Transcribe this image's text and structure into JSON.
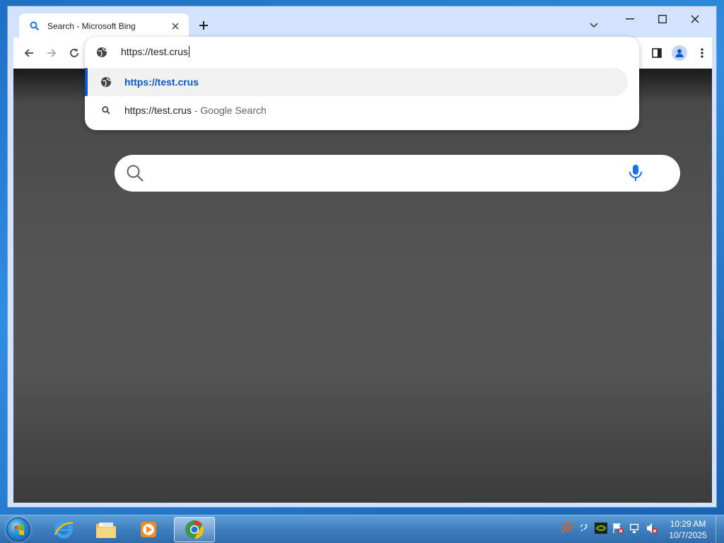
{
  "browser": {
    "tab": {
      "title": "Search - Microsoft Bing"
    },
    "omnibox": {
      "input_value": "https://test.crus",
      "suggestions": [
        {
          "text": "https://test.crus",
          "icon": "globe-icon"
        },
        {
          "text": "https://test.crus",
          "suffix": "Google Search",
          "separator": " - ",
          "icon": "search-icon"
        }
      ]
    }
  },
  "taskbar": {
    "clock": {
      "time": "10:29 AM",
      "date": "10/7/2025"
    },
    "items": [
      "internet-explorer-icon",
      "file-explorer-icon",
      "media-player-icon",
      "chrome-icon"
    ]
  },
  "colors": {
    "accent": "#0b57d0",
    "tabstrip": "#d3e3fd",
    "content_bg": "#545454"
  }
}
